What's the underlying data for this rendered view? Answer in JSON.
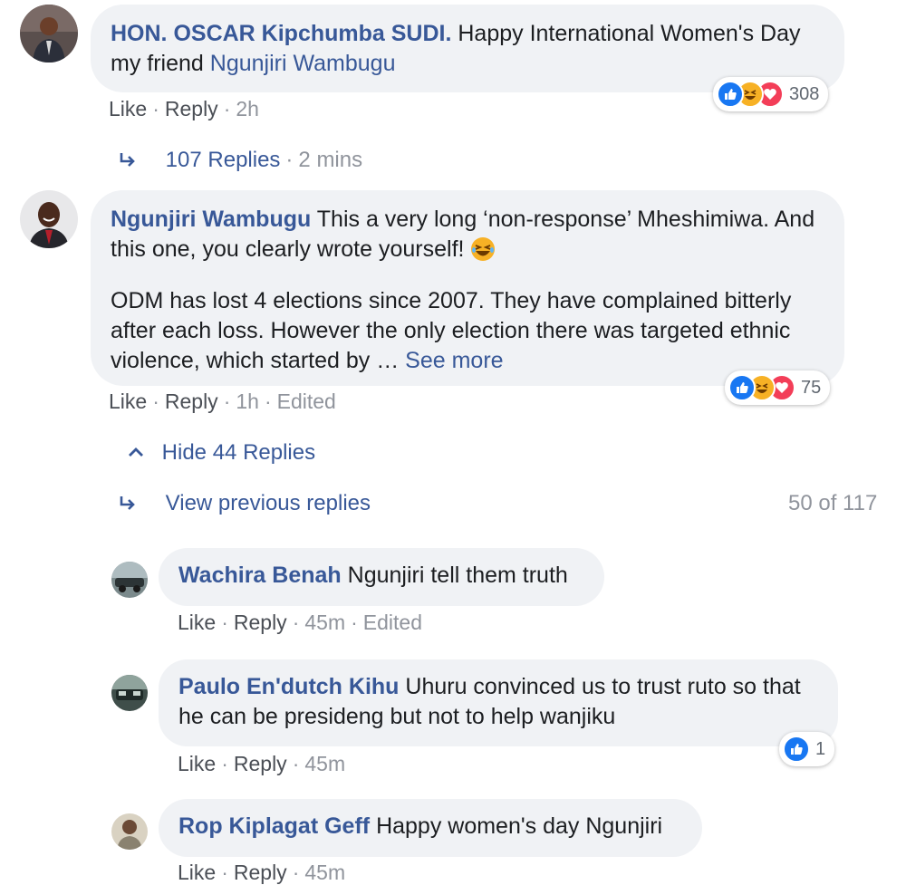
{
  "comments": [
    {
      "author": "HON. OSCAR Kipchumba SUDI.",
      "text": "Happy International Women's Day my friend",
      "mention": "Ngunjiri Wambugu",
      "actions": {
        "like": "Like",
        "reply": "Reply",
        "time": "2h"
      },
      "reactions": {
        "count": "308",
        "types": [
          "like-icon",
          "haha-icon",
          "love-icon"
        ]
      },
      "replies_link": {
        "label": "107 Replies",
        "time": "2 mins"
      }
    },
    {
      "author": "Ngunjiri Wambugu",
      "text_p1": "This a very long ‘non-response’ Mheshimiwa. And this one, you clearly wrote yourself!",
      "text_p2": "ODM has lost 4 elections since 2007. They have complained bitterly after each loss. However the only election there was targeted ethnic violence, which started by …",
      "see_more": "See more",
      "actions": {
        "like": "Like",
        "reply": "Reply",
        "time": "1h",
        "edited": "Edited"
      },
      "reactions": {
        "count": "75",
        "types": [
          "like-icon",
          "haha-icon",
          "love-icon"
        ]
      },
      "hide_replies": "Hide 44 Replies",
      "view_previous": "View previous replies",
      "pagination": "50 of 117"
    }
  ],
  "replies": [
    {
      "author": "Wachira Benah",
      "text": "Ngunjiri tell them truth",
      "actions": {
        "like": "Like",
        "reply": "Reply",
        "time": "45m",
        "edited": "Edited"
      }
    },
    {
      "author": "Paulo En'dutch Kihu",
      "text": "Uhuru convinced us to trust ruto so that he can be presideng but not to help wanjiku",
      "actions": {
        "like": "Like",
        "reply": "Reply",
        "time": "45m"
      },
      "reactions": {
        "count": "1",
        "types": [
          "like-icon"
        ]
      }
    },
    {
      "author": "Rop Kiplagat Geff",
      "text": "Happy women's day Ngunjiri",
      "actions": {
        "like": "Like",
        "reply": "Reply",
        "time": "45m"
      }
    }
  ],
  "colors": {
    "link": "#385898",
    "bubble": "#f0f2f5",
    "meta": "#90949c",
    "like": "#1877f2",
    "haha": "#f7b125",
    "love": "#f33e58"
  }
}
